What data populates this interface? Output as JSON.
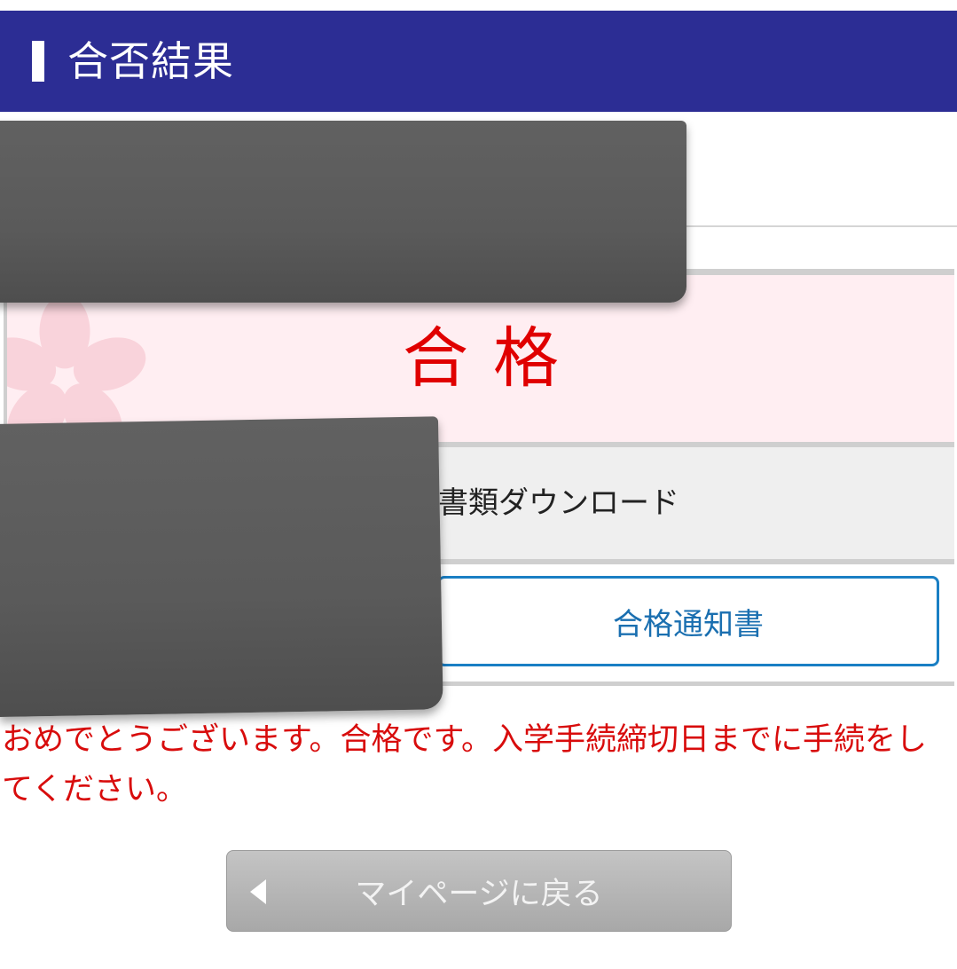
{
  "header": {
    "title": "合否結果"
  },
  "result": {
    "text": "合格"
  },
  "documents": {
    "label": "書類ダウンロード"
  },
  "notice_button": {
    "label": "合格通知書"
  },
  "message": "おめでとうございます。合格です。入学手続締切日までに手続をしてください。",
  "back_button": {
    "label": "マイページに戻る"
  },
  "colors": {
    "header_bg": "#2c2d94",
    "result_red": "#e00000",
    "link_blue": "#1a7fc4",
    "message_red": "#d80c0c",
    "result_bg": "#ffeef2"
  },
  "icons": {
    "result_decoration": "sakura-icon",
    "back": "left-triangle-icon"
  }
}
